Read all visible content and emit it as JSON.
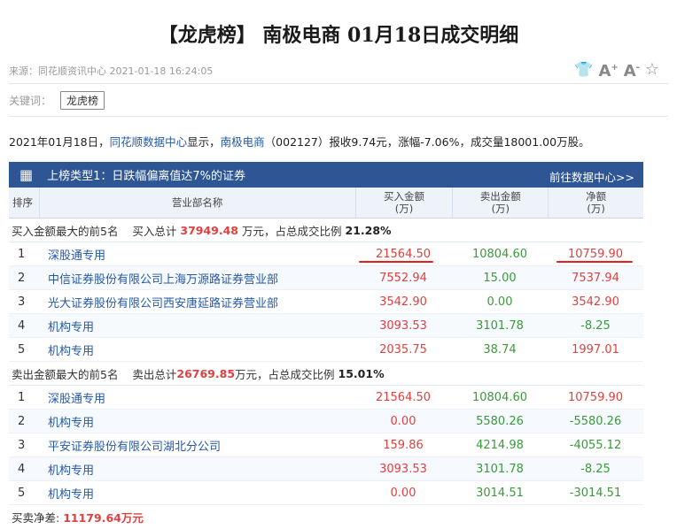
{
  "article": {
    "title": "【龙虎榜】 南极电商 01月18日成交明细",
    "source": "来源：同花顺资讯中心 2021-01-18 16:24:05",
    "keywords_label": "关键词：",
    "keyword_tag": "龙虎榜",
    "desc": {
      "date": "2021年01月18日，",
      "center": "同花顺数据中心",
      "show": "显示，",
      "stock": "南极电商",
      "rest": "（002127）报收9.74元，涨幅-7.06%，成交量18001.00万股。"
    },
    "tools": {
      "shirt": "shirt-icon",
      "font_up": "A",
      "font_down": "A",
      "star": "☆"
    }
  },
  "table": {
    "header_title": "上榜类型1：日跌幅偏离值达7%的证券",
    "header_link": "前往数据中心>>",
    "cols": {
      "rank": "排序",
      "name": "营业部名称",
      "buy": "买入金额",
      "sell": "卖出金额",
      "net": "净额",
      "unit": "(万)"
    },
    "buy_summary": {
      "label": "买入金额最大的前5名",
      "total_label": "买入总计",
      "total": "37949.48",
      "unit": "万元，占总成交比例",
      "pct": "21.28%"
    },
    "buy_rows": [
      {
        "rank": "1",
        "name": "深股通专用",
        "buy": "21564.50",
        "sell": "10804.60",
        "net": "10759.90",
        "neg": false
      },
      {
        "rank": "2",
        "name": "中信证券股份有限公司上海万源路证券营业部",
        "buy": "7552.94",
        "sell": "15.00",
        "net": "7537.94",
        "neg": false
      },
      {
        "rank": "3",
        "name": "光大证券股份有限公司西安唐延路证券营业部",
        "buy": "3542.90",
        "sell": "0.00",
        "net": "3542.90",
        "neg": false
      },
      {
        "rank": "4",
        "name": "机构专用",
        "buy": "3093.53",
        "sell": "3101.78",
        "net": "-8.25",
        "neg": true
      },
      {
        "rank": "5",
        "name": "机构专用",
        "buy": "2035.75",
        "sell": "38.74",
        "net": "1997.01",
        "neg": false
      }
    ],
    "sell_summary": {
      "label": "卖出金额最大的前5名",
      "total_label": "卖出总计",
      "total": "26769.85",
      "unit": "万元，占总成交比例",
      "pct": "15.01%"
    },
    "sell_rows": [
      {
        "rank": "1",
        "name": "深股通专用",
        "buy": "21564.50",
        "sell": "10804.60",
        "net": "10759.90",
        "neg": false
      },
      {
        "rank": "2",
        "name": "机构专用",
        "buy": "0.00",
        "sell": "5580.26",
        "net": "-5580.26",
        "neg": true
      },
      {
        "rank": "3",
        "name": "平安证券股份有限公司湖北分公司",
        "buy": "159.86",
        "sell": "4214.98",
        "net": "-4055.12",
        "neg": true
      },
      {
        "rank": "4",
        "name": "机构专用",
        "buy": "3093.53",
        "sell": "3101.78",
        "net": "-8.25",
        "neg": true
      },
      {
        "rank": "5",
        "name": "机构专用",
        "buy": "0.00",
        "sell": "3014.51",
        "net": "-3014.51",
        "neg": true
      }
    ],
    "net_label": "买卖净差:",
    "net_value": "11179.64万元"
  }
}
